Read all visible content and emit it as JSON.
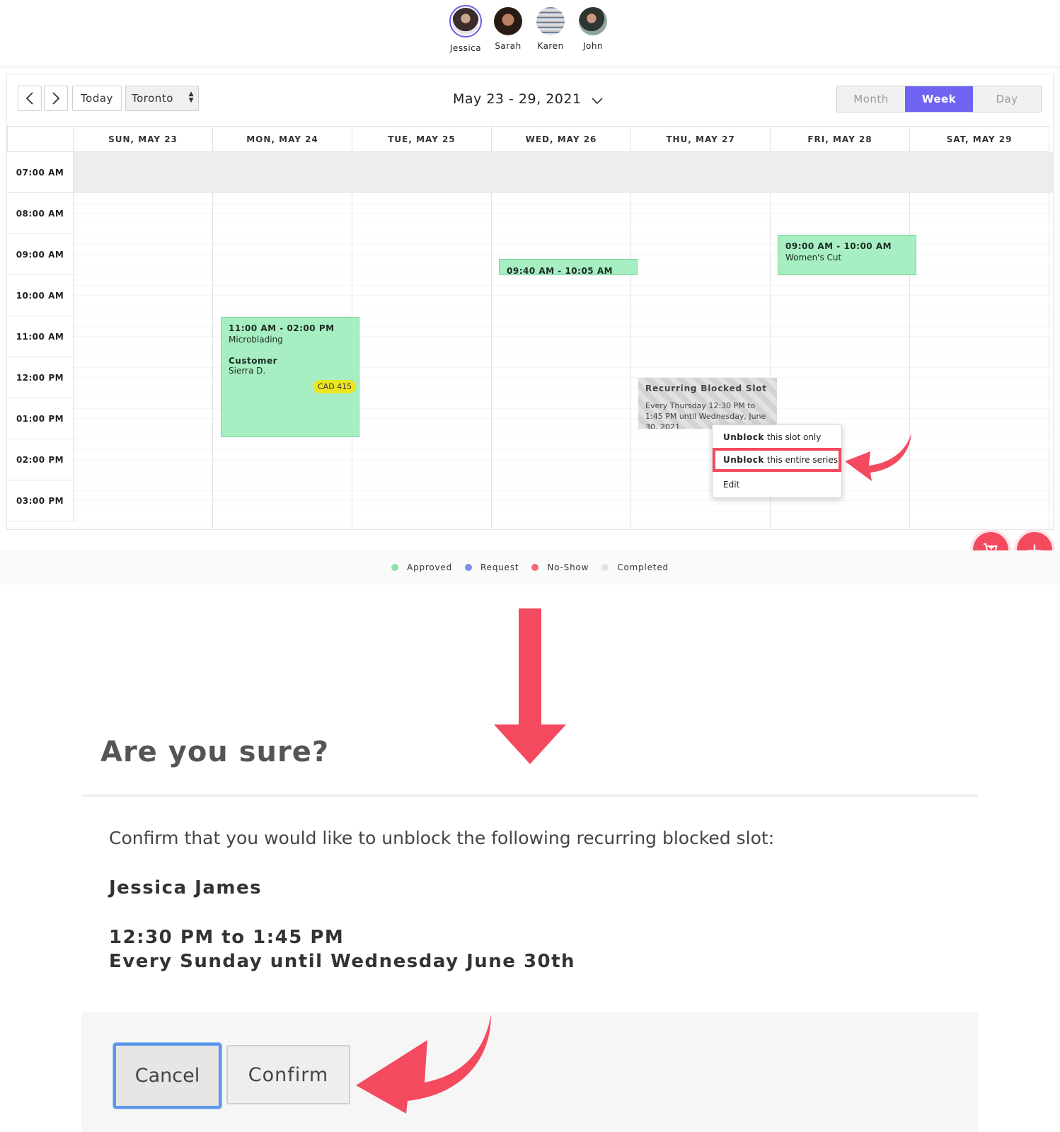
{
  "staff": [
    {
      "name": "Jessica",
      "selected": true,
      "avatar_color": "#4a3a3a"
    },
    {
      "name": "Sarah",
      "selected": false,
      "avatar_color": "#5a3b2c"
    },
    {
      "name": "Karen",
      "selected": false,
      "avatar_color": "#7b8ea6"
    },
    {
      "name": "John",
      "selected": false,
      "avatar_color": "#3f4744"
    }
  ],
  "toolbar": {
    "prev_icon": "chevron-left-icon",
    "next_icon": "chevron-right-icon",
    "today_label": "Today",
    "location_value": "Toronto",
    "date_range": "May 23 - 29, 2021",
    "views": [
      {
        "label": "Month",
        "active": false
      },
      {
        "label": "Week",
        "active": true
      },
      {
        "label": "Day",
        "active": false
      }
    ]
  },
  "calendar": {
    "days": [
      "SUN, MAY 23",
      "MON, MAY 24",
      "TUE, MAY 25",
      "WED, MAY 26",
      "THU, MAY 27",
      "FRI, MAY 28",
      "SAT, MAY 29"
    ],
    "times": [
      "07:00 AM",
      "08:00 AM",
      "09:00 AM",
      "10:00 AM",
      "11:00 AM",
      "12:00 PM",
      "01:00 PM",
      "02:00 PM",
      "03:00 PM"
    ],
    "events": [
      {
        "time": "11:00 AM - 02:00 PM",
        "service": "Microblading",
        "customer_label": "Customer",
        "customer": "Sierra D.",
        "price": "CAD 415"
      },
      {
        "time": "09:40 AM - 10:05 AM"
      },
      {
        "time": "09:00 AM - 10:00 AM",
        "service": "Women's Cut"
      }
    ],
    "blocked": {
      "title": "Recurring Blocked Slot",
      "detail": "Every Thursday 12:30 PM to 1:45 PM until Wednesday, June 30, 2021"
    }
  },
  "context_menu": {
    "items": [
      {
        "bold": "Unblock",
        "rest": "this slot only"
      },
      {
        "bold": "Unblock",
        "rest": "this entire series"
      },
      {
        "bold": "",
        "rest": "Edit"
      }
    ]
  },
  "legend": [
    {
      "label": "Approved",
      "color": "#8ee0ad"
    },
    {
      "label": "Request",
      "color": "#7b8fe6"
    },
    {
      "label": "No-Show",
      "color": "#f26a74"
    },
    {
      "label": "Completed",
      "color": "#e2e2e2"
    }
  ],
  "fab": {
    "cart_icon": "cart-add-icon",
    "add_icon": "plus-icon",
    "add_symbol": "+"
  },
  "dialog": {
    "title": "Are you sure?",
    "body": "Confirm that you would like to unblock the following recurring blocked slot:",
    "name": "Jessica James",
    "time_range": "12:30 PM to 1:45 PM",
    "recurrence": "Every Sunday until Wednesday June 30th",
    "cancel_label": "Cancel",
    "confirm_label": "Confirm"
  },
  "colors": {
    "accent": "#6f63f2",
    "arrow": "#f34a60",
    "event_green": "#a7eec2"
  }
}
